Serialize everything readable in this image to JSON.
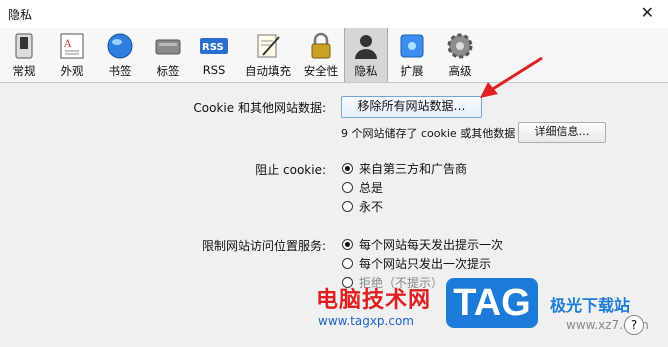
{
  "window": {
    "title": "隐私"
  },
  "toolbar": {
    "items": [
      {
        "label": "常规",
        "icon": "switch-icon"
      },
      {
        "label": "外观",
        "icon": "appearance-icon"
      },
      {
        "label": "书签",
        "icon": "globe-icon"
      },
      {
        "label": "标签",
        "icon": "tabs-icon"
      },
      {
        "label": "RSS",
        "icon": "rss-icon"
      },
      {
        "label": "自动填充",
        "icon": "autofill-icon"
      },
      {
        "label": "安全性",
        "icon": "lock-icon"
      },
      {
        "label": "隐私",
        "icon": "user-silhouette-icon",
        "selected": true
      },
      {
        "label": "扩展",
        "icon": "puzzle-icon"
      },
      {
        "label": "高级",
        "icon": "gear-icon"
      }
    ]
  },
  "cookies": {
    "label": "Cookie 和其他网站数据:",
    "remove_button": "移除所有网站数据…",
    "summary": "9 个网站储存了 cookie 或其他数据",
    "details_button": "详细信息…"
  },
  "block_cookies": {
    "label": "阻止 cookie:",
    "options": [
      "来自第三方和广告商",
      "总是",
      "永不"
    ],
    "selected": 0
  },
  "location": {
    "label": "限制网站访问位置服务:",
    "options": [
      "每个网站每天发出提示一次",
      "每个网站只发出一次提示",
      "拒绝（不提示）"
    ],
    "selected": 0
  },
  "help": {
    "label": "?"
  },
  "watermark": {
    "site_name": "电脑技术网",
    "site_url": "www.tagxp.com",
    "tag": "TAG",
    "brand": "极光下载站",
    "brand_url": "www.xz7.com"
  },
  "colors": {
    "accent": "#1c7bd8",
    "arrow": "#e02020"
  }
}
